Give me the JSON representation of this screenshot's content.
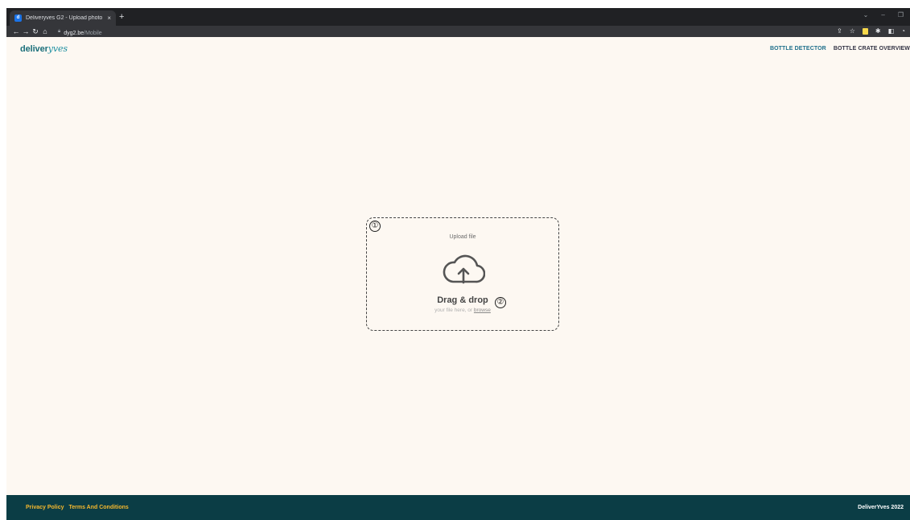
{
  "browser": {
    "tab_title": "Deliveryves G2 - Upload photo",
    "tab_close": "×",
    "new_tab": "+",
    "url_host": "dyg2.be",
    "url_path": "/Mobile",
    "favicon_text": "d"
  },
  "header": {
    "logo_bold": "deliver",
    "logo_light": "yves",
    "nav": [
      {
        "label": "BOTTLE DETECTOR",
        "active": true
      },
      {
        "label": "BOTTLE CRATE OVERVIEW",
        "active": false
      }
    ]
  },
  "upload": {
    "title": "Upload file",
    "icon": "cloud-upload-icon",
    "drag_drop": "Drag & drop",
    "sub_prefix": "your file here, or ",
    "browse": "browse",
    "markers": [
      "①",
      "②"
    ]
  },
  "footer": {
    "links": [
      "Privacy Policy",
      "Terms And Conditions"
    ],
    "copyright": "DeliverYves 2022"
  },
  "colors": {
    "page_bg": "#fdf8f2",
    "footer_bg": "#0b3d45",
    "footer_link": "#f5b82e",
    "nav_active": "#1f6f8b"
  }
}
